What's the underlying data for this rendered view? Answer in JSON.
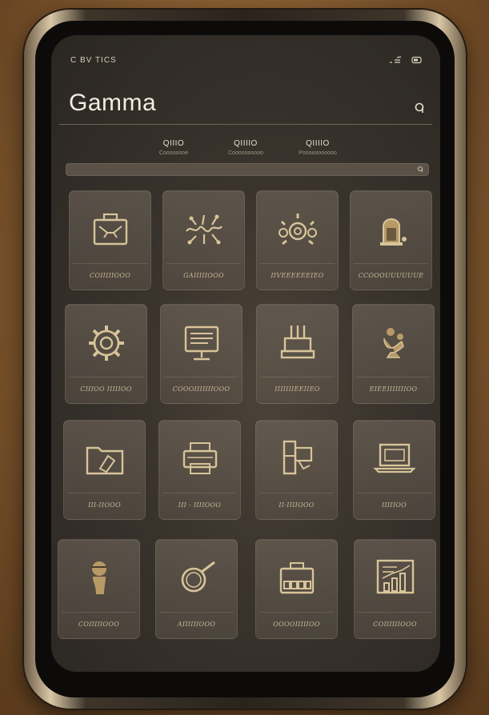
{
  "status": {
    "text": "C BV TICS"
  },
  "header": {
    "title": "Gamma"
  },
  "tabs": [
    {
      "label": "QIIIO",
      "sub": "Coooooooe"
    },
    {
      "label": "QIIIIO",
      "sub": "Coooooooooo"
    },
    {
      "label": "QIIIIO",
      "sub": "Pooooooooooo"
    }
  ],
  "search": {
    "placeholder": ""
  },
  "tiles": [
    {
      "label": "COIIIIIOOO",
      "icon": "briefcase-icon"
    },
    {
      "label": "GAIIIIIOOO",
      "icon": "circuit-icon"
    },
    {
      "label": "IIVEEEEEEIEO",
      "icon": "gear-cluster-icon"
    },
    {
      "label": "CCOOOUUUUUUE",
      "icon": "figure-icon"
    },
    {
      "label": "CIIIOO IIIIIOO",
      "icon": "gear-icon"
    },
    {
      "label": "COOOIIIIIIIOOO",
      "icon": "monitor-icon"
    },
    {
      "label": "IIIIIIIEEIIEO",
      "icon": "tools-icon"
    },
    {
      "label": "EIEEIIIIIIIOO",
      "icon": "statue-icon"
    },
    {
      "label": "III-IIOOO",
      "icon": "folder-icon"
    },
    {
      "label": "III - IIIIOOO",
      "icon": "printer-icon"
    },
    {
      "label": "II-IIIIOOO",
      "icon": "machine-icon"
    },
    {
      "label": "IIIIIOO",
      "icon": "laptop-icon"
    },
    {
      "label": "COIIIIIOOO",
      "icon": "bust-icon"
    },
    {
      "label": "AIIIIIIOOO",
      "icon": "pan-icon"
    },
    {
      "label": "OOOOIIIIIOO",
      "icon": "bag-icon"
    },
    {
      "label": "COIIIIIIOOO",
      "icon": "dashboard-icon"
    }
  ],
  "colors": {
    "accent": "#d8c49a",
    "background": "#3a342d",
    "title": "#f2ece1"
  }
}
